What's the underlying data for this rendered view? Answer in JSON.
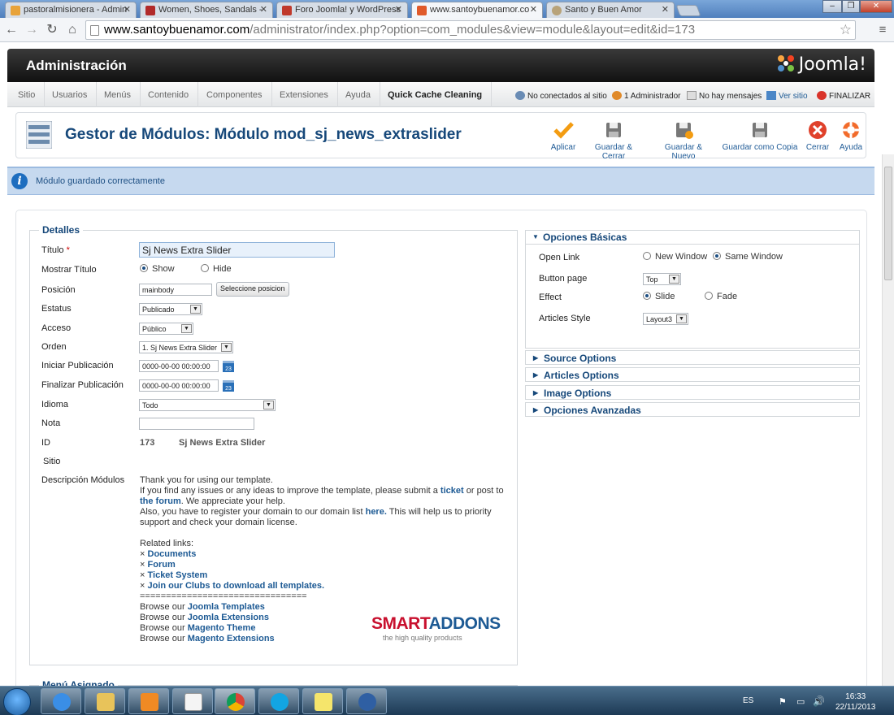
{
  "browser": {
    "tabs": [
      {
        "title": "pastoralmisionera - Admin",
        "active": false,
        "favicon_color": "#e8a33a"
      },
      {
        "title": "Women, Shoes, Sandals -",
        "active": false,
        "favicon_color": "#b12a2a"
      },
      {
        "title": "Foro Joomla! y WordPress",
        "active": false,
        "favicon_color": "#c0392b"
      },
      {
        "title": "www.santoybuenamor.co",
        "active": true,
        "favicon_color": "#e05a2a"
      },
      {
        "title": "Santo y Buen Amor",
        "active": false,
        "favicon_color": "#b8a37a"
      }
    ],
    "url_host": "www.santoybuenamor.com",
    "url_path": "/administrator/index.php?option=com_modules&view=module&layout=edit&id=173"
  },
  "header": {
    "title": "Administración",
    "logo_text": "Joomla!"
  },
  "menu": {
    "items": [
      "Sitio",
      "Usuarios",
      "Menús",
      "Contenido",
      "Componentes",
      "Extensiones",
      "Ayuda",
      "Quick Cache Cleaning"
    ],
    "status": {
      "not_connected": "No conectados al sitio",
      "admins": "1 Administrador",
      "messages": "No hay mensajes",
      "view_site": "Ver sitio",
      "logout": "FINALIZAR"
    }
  },
  "toolbar": {
    "page_title": "Gestor de Módulos: Módulo mod_sj_news_extraslider",
    "buttons": {
      "apply": "Aplicar",
      "save_close": "Guardar & Cerrar",
      "save_new": "Guardar & Nuevo",
      "save_copy": "Guardar como Copia",
      "close": "Cerrar",
      "help": "Ayuda"
    }
  },
  "message": "Módulo guardado correctamente",
  "details": {
    "legend": "Detalles",
    "labels": {
      "title": "Título",
      "show_title": "Mostrar Título",
      "position": "Posición",
      "status": "Estatus",
      "access": "Acceso",
      "ordering": "Orden",
      "publish_up": "Iniciar Publicación",
      "publish_down": "Finalizar Publicación",
      "language": "Idioma",
      "note": "Nota",
      "id": "ID",
      "site": "Sitio",
      "description": "Descripción Módulos"
    },
    "required_mark": "*",
    "title_value": "Sj News Extra Slider",
    "show_label": "Show",
    "hide_label": "Hide",
    "show_selected": true,
    "position_value": "mainbody",
    "select_position_button": "Seleccione posicion",
    "status_value": "Publicado",
    "access_value": "Público",
    "ordering_value": "1. Sj News Extra Slider",
    "publish_up_value": "0000-00-00 00:00:00",
    "publish_down_value": "0000-00-00 00:00:00",
    "calendar_label": "23",
    "language_value": "Todo",
    "note_value": "",
    "id_value": "173",
    "id_name": "Sj News Extra Slider",
    "desc": {
      "line1": "Thank you for using our template.",
      "line2a": "If you find any issues or any ideas to improve the template, please submit a ",
      "line2_link": "ticket",
      "line2b": " or post to",
      "line3_link": "the forum",
      "line3b": ". We appreciate your help.",
      "line4a": "Also, you have to register your domain to our domain list ",
      "line4_link": "here.",
      "line4b": " This will help us to priority",
      "line5": "support and check your domain license.",
      "related": "Related links:",
      "bullet": "×",
      "links": [
        "Documents",
        "Forum",
        "Ticket System",
        "Join our Clubs to download all templates."
      ],
      "separator": "================================",
      "browse_prefix": "Browse our ",
      "browse_links": [
        "Joomla Templates",
        "Joomla Extensions",
        "Magento Theme",
        "Magento Extensions"
      ],
      "brand_smart": "SMART",
      "brand_addons": "ADDONS",
      "brand_tagline": "the high quality products"
    }
  },
  "assigned_menu_legend": "Menú Asignado",
  "options": {
    "basic_title": "Opciones Básicas",
    "open_link_label": "Open Link",
    "new_window": "New Window",
    "same_window": "Same Window",
    "button_page_label": "Button page",
    "button_page_value": "Top",
    "effect_label": "Effect",
    "slide": "Slide",
    "fade": "Fade",
    "articles_style_label": "Articles Style",
    "articles_style_value": "Layout3",
    "panels": [
      "Source Options",
      "Articles Options",
      "Image Options",
      "Opciones Avanzadas"
    ]
  },
  "taskbar": {
    "lang": "ES",
    "time": "16:33",
    "date": "22/11/2013",
    "apps": [
      "internet-explorer",
      "file-explorer",
      "media-player",
      "notepad",
      "chrome",
      "skype",
      "notes",
      "thunderbird"
    ]
  },
  "colors": {
    "joomla_blue": "#16487a",
    "link_blue": "#1d5a94",
    "message_bg": "#c6d9ef"
  }
}
